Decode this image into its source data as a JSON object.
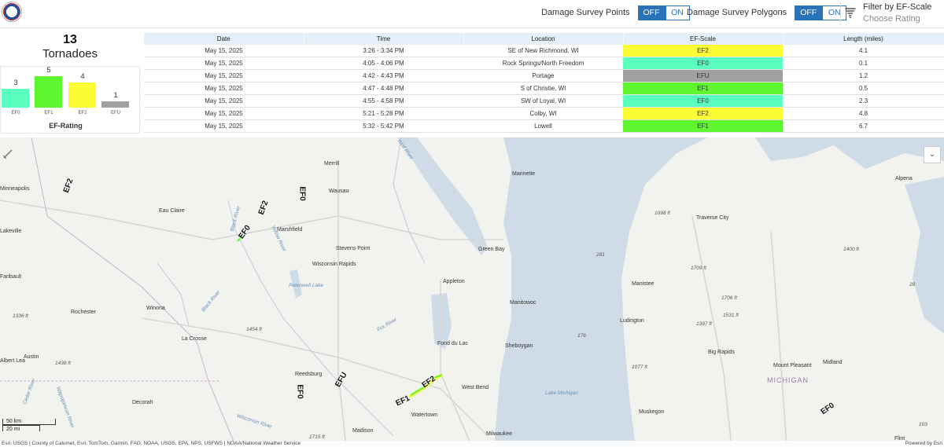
{
  "header": {
    "points": {
      "label": "Damage Survey Points",
      "off": "OFF",
      "on": "ON"
    },
    "polygons": {
      "label": "Damage Survey Polygons",
      "off": "OFF",
      "on": "ON"
    },
    "filter": {
      "title": "Filter by EF-Scale",
      "placeholder": "Choose Rating"
    }
  },
  "summary": {
    "count": "13",
    "label": "Tornadoes"
  },
  "ratings": {
    "title": "EF-Rating",
    "bars": [
      {
        "cat": "EF0",
        "value": 3,
        "color": "#5bffbf"
      },
      {
        "cat": "EF1",
        "value": 5,
        "color": "#5ef72f"
      },
      {
        "cat": "EF2",
        "value": 4,
        "color": "#fbfc33"
      },
      {
        "cat": "EFU",
        "value": 1,
        "color": "#a0a0a0"
      }
    ]
  },
  "table": {
    "headers": [
      "Date",
      "Time",
      "Location",
      "EF-Scale",
      "Length (miles)"
    ],
    "rows": [
      {
        "date": "May 15, 2025",
        "time": "3:26 - 3:34 PM",
        "location": "SE of New Richmond, WI",
        "ef": "EF2",
        "color": "#fbfc33",
        "length": "4.1"
      },
      {
        "date": "May 15, 2025",
        "time": "4:05 - 4:06 PM",
        "location": "Rock Springs/North Freedom",
        "ef": "EF0",
        "color": "#5bffbf",
        "length": "0.1"
      },
      {
        "date": "May 15, 2025",
        "time": "4:42 - 4:43 PM",
        "location": "Portage",
        "ef": "EFU",
        "color": "#a0a0a0",
        "length": "1.2"
      },
      {
        "date": "May 15, 2025",
        "time": "4:47 - 4:48 PM",
        "location": "S of Christie, WI",
        "ef": "EF1",
        "color": "#5ef72f",
        "length": "0.5"
      },
      {
        "date": "May 15, 2025",
        "time": "4:55 - 4:58 PM",
        "location": "SW of Loyal, WI",
        "ef": "EF0",
        "color": "#5bffbf",
        "length": "2.3"
      },
      {
        "date": "May 15, 2025",
        "time": "5:21 - 5:28 PM",
        "location": "Colby, WI",
        "ef": "EF2",
        "color": "#fbfc33",
        "length": "4.8"
      },
      {
        "date": "May 15, 2025",
        "time": "5:32 - 5:42 PM",
        "location": "Lowell",
        "ef": "EF1",
        "color": "#5ef72f",
        "length": "6.7"
      }
    ]
  },
  "map": {
    "cities": [
      "Minneapolis",
      "Merrill",
      "Marinette",
      "Wausau",
      "Eau Claire",
      "Marshfield",
      "Lakeville",
      "Stevens Point",
      "Green Bay",
      "Wisconsin Rapids",
      "Faribault",
      "Appleton",
      "Manitowoc",
      "Rochester",
      "Winona",
      "La Crosse",
      "Fond du Lac",
      "Sheboygan",
      "Austin",
      "Reedsburg",
      "West Bend",
      "Decorah",
      "Watertown",
      "Madison",
      "Milwaukee",
      "Alpena",
      "Traverse City",
      "Manistee",
      "Ludington",
      "Big Rapids",
      "Mount Pleasant",
      "Midland",
      "Muskegon",
      "Flint",
      "Albert Lea"
    ],
    "elevations": [
      "1098 ft",
      "1400 ft",
      "1709 ft",
      "1706 ft",
      "1531 ft",
      "1397 ft",
      "1336 ft",
      "1454 ft",
      "1438 ft",
      "1077 ft",
      "1715 ft",
      "28",
      "281",
      "176",
      "103"
    ],
    "rivers": [
      "Wolf River",
      "Black River",
      "Yellow River",
      "Petenwell Lake",
      "Black River",
      "Fox River",
      "Lake Michigan",
      "Wisconsin River",
      "Cedar River",
      "Wapsipinicon River"
    ],
    "state": "MICHIGAN",
    "ef_labels": [
      "EF2",
      "EF0",
      "EF2",
      "EF0",
      "EFU",
      "EF0",
      "EF2",
      "EF1",
      "EF0"
    ],
    "scale": {
      "km": "50 km",
      "mi": "20 mi"
    },
    "attribution": "Esri, USGS | County of Calumet, Esri, TomTom, Garmin, FAO, NOAA, USGS, EPA, NPS, USFWS | NOAA/National Weather Service",
    "powered": "Powered by Esri"
  },
  "colors": {
    "accent": "#2b73b8",
    "table_header": "#e4effa",
    "water": "#cfdce8",
    "land": "#f2f2ef"
  }
}
